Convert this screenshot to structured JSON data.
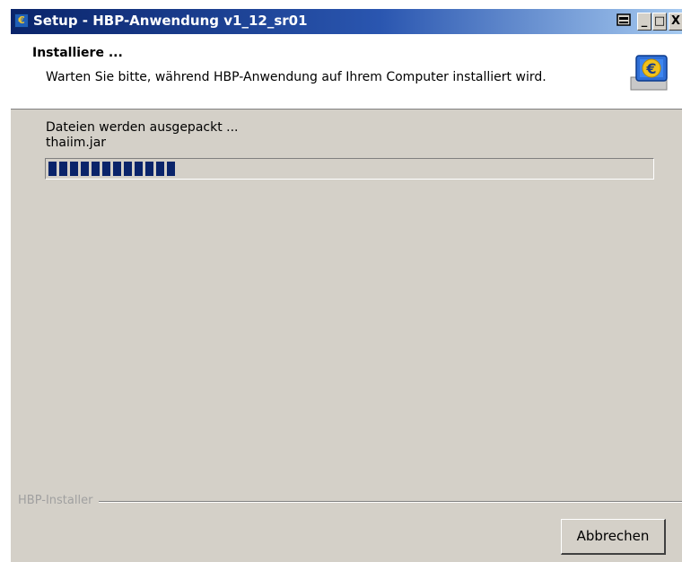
{
  "window": {
    "title": "Setup - HBP-Anwendung v1_12_sr01",
    "controls": {
      "minimize": "_",
      "maximize": "□",
      "close": "X"
    }
  },
  "header": {
    "title": "Installiere ...",
    "subtitle": "Warten Sie bitte, während HBP-Anwendung auf Ihrem Computer installiert wird.",
    "icon": "monitor-euro-icon"
  },
  "progress": {
    "status": "Dateien werden ausgepackt ...",
    "file": "thaiim.jar",
    "fraction": 0.21,
    "color": "#0a246a"
  },
  "footer": {
    "group_label": "HBP-Installer",
    "cancel_label": "Abbrechen"
  }
}
